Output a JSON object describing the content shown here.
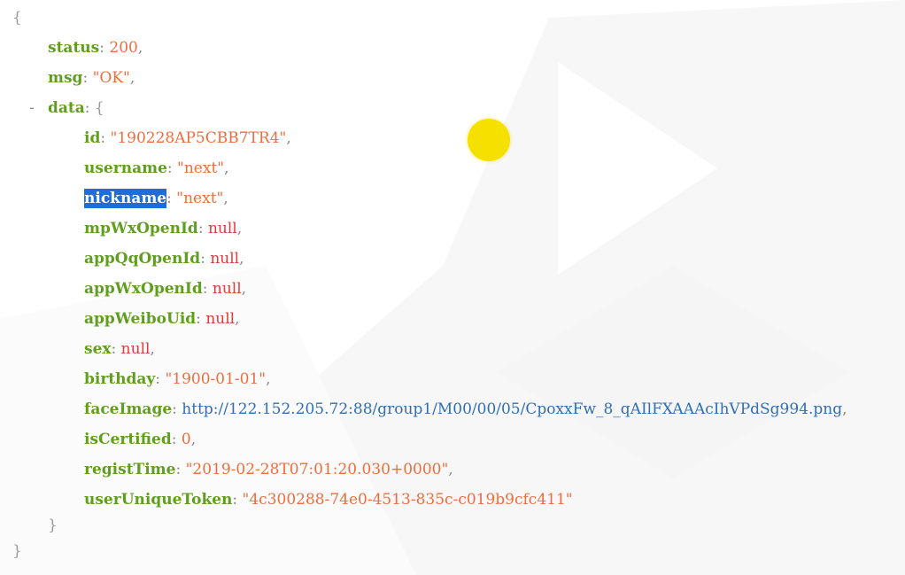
{
  "json_viewer": {
    "open_brace": "{",
    "close_brace": "}",
    "data_close_brace": "}",
    "toggle_symbol": "-",
    "status": {
      "key": "status",
      "value": "200"
    },
    "msg": {
      "key": "msg",
      "value": "\"OK\""
    },
    "data": {
      "key": "data",
      "open": "{",
      "fields": [
        {
          "key": "id",
          "value": "\"190228AP5CBB7TR4\"",
          "type": "string"
        },
        {
          "key": "username",
          "value": "\"next\"",
          "type": "string"
        },
        {
          "key": "nickname",
          "value": "\"next\"",
          "type": "string",
          "selected": true
        },
        {
          "key": "mpWxOpenId",
          "value": "null",
          "type": "null"
        },
        {
          "key": "appQqOpenId",
          "value": "null",
          "type": "null"
        },
        {
          "key": "appWxOpenId",
          "value": "null",
          "type": "null"
        },
        {
          "key": "appWeiboUid",
          "value": "null",
          "type": "null"
        },
        {
          "key": "sex",
          "value": "null",
          "type": "null"
        },
        {
          "key": "birthday",
          "value": "\"1900-01-01\"",
          "type": "string"
        },
        {
          "key": "faceImage",
          "value": "http://122.152.205.72:88/group1/M00/00/05/CpoxxFw_8_qAIlFXAAAcIhVPdSg994.png",
          "type": "url"
        },
        {
          "key": "isCertified",
          "value": "0",
          "type": "number"
        },
        {
          "key": "registTime",
          "value": "\"2019-02-28T07:01:20.030+0000\"",
          "type": "string"
        },
        {
          "key": "userUniqueToken",
          "value": "\"4c300288-74e0-4513-835c-c019b9cfc411\"",
          "type": "string"
        }
      ]
    }
  },
  "colors": {
    "key": "#5f9e1f",
    "string": "#ee6d3d",
    "null": "#e03a3a",
    "url": "#2f6fb3",
    "selection": "#1e6ed8",
    "cursor_highlight": "#f5e000"
  }
}
